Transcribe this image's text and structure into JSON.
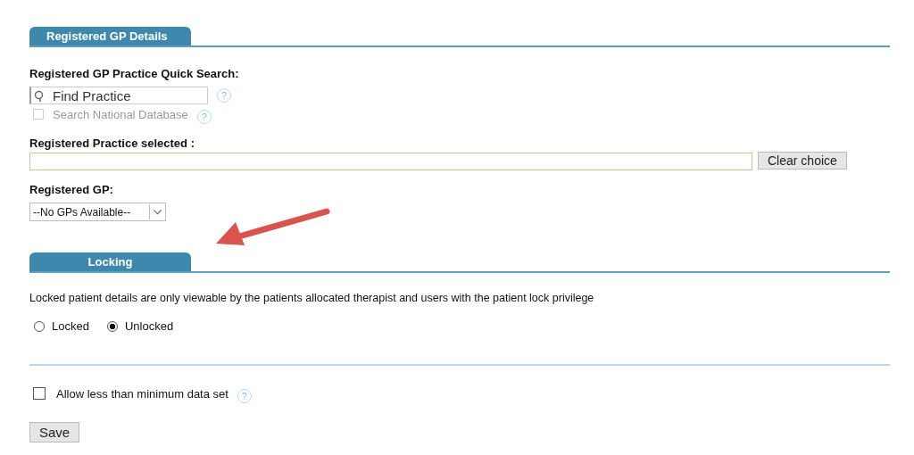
{
  "gp_section": {
    "tab": "Registered GP Details",
    "quick_search_label": "Registered GP Practice Quick Search:",
    "search": {
      "placeholder": "Find Practice",
      "help": "?"
    },
    "national": {
      "label": "Search National Database",
      "checked": false,
      "disabled": true,
      "help": "?"
    },
    "selected_label": "Registered Practice selected :",
    "clear_button": "Clear choice",
    "gp_label": "Registered GP:",
    "gp_select": "--No GPs Available--"
  },
  "locking_section": {
    "tab": "Locking",
    "description": "Locked patient details are only viewable by the patients allocated therapist and users with the patient lock privilege",
    "options": [
      {
        "label": "Locked",
        "selected": false
      },
      {
        "label": "Unlocked",
        "selected": true
      }
    ]
  },
  "minimum": {
    "label": "Allow less than minimum data set",
    "checked": false,
    "help": "?"
  },
  "save_button": "Save"
}
